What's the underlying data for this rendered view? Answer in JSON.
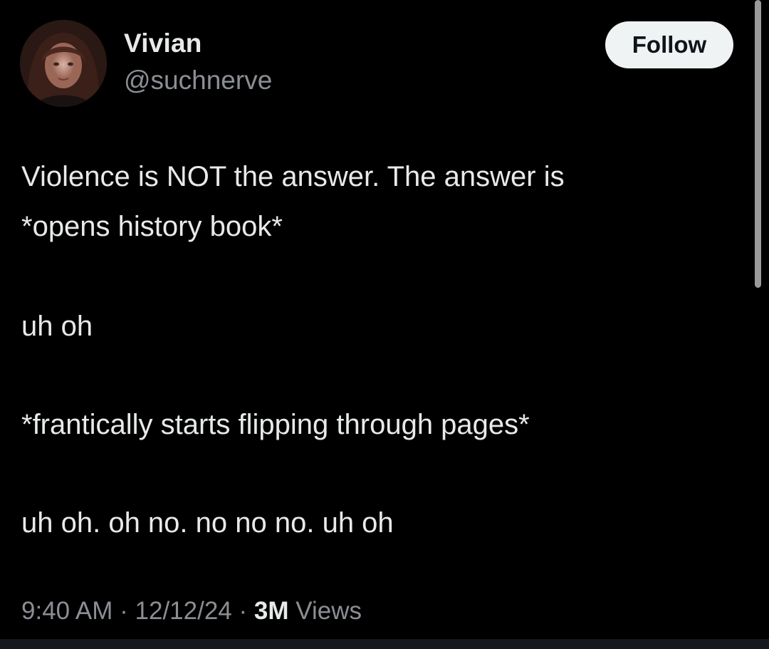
{
  "user": {
    "display_name": "Vivian",
    "handle": "@suchnerve"
  },
  "follow_button": {
    "label": "Follow"
  },
  "tweet": {
    "lines": [
      "Violence is NOT the answer. The answer is",
      "*opens history book*",
      "uh oh",
      "*frantically starts flipping through pages*",
      "uh oh. oh no. no no no. uh oh"
    ]
  },
  "meta": {
    "time": "9:40 AM",
    "separator": " · ",
    "date": "12/12/24",
    "views_count": "3M",
    "views_label": " Views"
  },
  "colors": {
    "background": "#000000",
    "primary_text": "#e7e9ea",
    "secondary_text": "#8b8f94",
    "follow_button_bg": "#eff3f4",
    "follow_button_text": "#0f1419"
  },
  "icons": {
    "avatar": "profile-photo"
  }
}
